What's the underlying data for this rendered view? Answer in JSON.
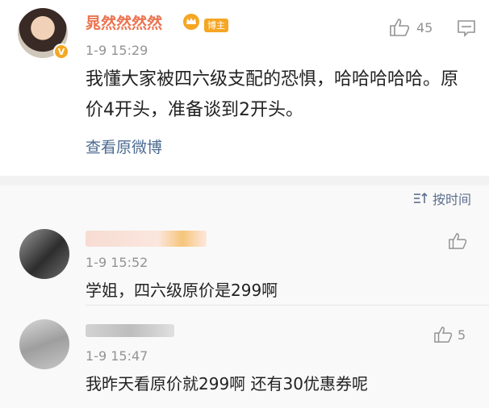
{
  "post": {
    "username": "晁然然然然",
    "tag": "博主",
    "time": "1-9 15:29",
    "like_count": "45",
    "content": "我懂大家被四六级支配的恐惧，哈哈哈哈哈。原价4开头，准备谈到2开头。",
    "view_original": "查看原微博"
  },
  "comments_header": {
    "sort_label": "按时间"
  },
  "comments": [
    {
      "time": "1-9 15:52",
      "text": "学姐，四六级原价是299啊",
      "like_count": ""
    },
    {
      "time": "1-9 15:47",
      "text": "我昨天看原价就299啊  还有30优惠券呢",
      "like_count": "5"
    }
  ],
  "colors": {
    "username": "#eb7350",
    "link": "#4c6b91",
    "badge": "#f5a623"
  }
}
